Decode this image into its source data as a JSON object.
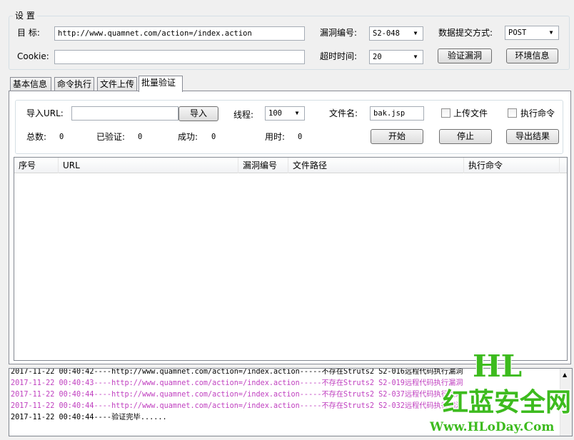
{
  "settings": {
    "group_title": "设 置",
    "target_label": "目  标:",
    "target_value": "http://www.quamnet.com/action=/index.action",
    "cookie_label": "Cookie:",
    "cookie_value": "",
    "vuln_id_label": "漏洞编号:",
    "vuln_id_value": "S2-048",
    "submit_method_label": "数据提交方式:",
    "submit_method_value": "POST",
    "timeout_label": "超时时间:",
    "timeout_value": "20",
    "verify_button": "验证漏洞",
    "env_button": "环境信息"
  },
  "tabs": [
    "基本信息",
    "命令执行",
    "文件上传",
    "批量验证"
  ],
  "batch": {
    "import_url_label": "导入URL:",
    "import_url_value": "",
    "import_button": "导入",
    "threads_label": "线程:",
    "threads_value": "100",
    "filename_label": "文件名:",
    "filename_value": "bak.jsp",
    "upload_file_label": "上传文件",
    "exec_cmd_label": "执行命令",
    "total_label": "总数:",
    "total_value": "0",
    "verified_label": "已验证:",
    "verified_value": "0",
    "success_label": "成功:",
    "success_value": "0",
    "time_label": "用时:",
    "time_value": "0",
    "start_button": "开始",
    "stop_button": "停止",
    "export_button": "导出结果",
    "columns": [
      "序号",
      "URL",
      "漏洞编号",
      "文件路径",
      "执行命令"
    ]
  },
  "log": {
    "lines": [
      {
        "text": "2017-11-22 00:40:42----http://www.quamnet.com/action=/index.action-----不存在Struts2 S2-016远程代码执行漏洞",
        "color": "#000000"
      },
      {
        "text": "2017-11-22 00:40:43----http://www.quamnet.com/action=/index.action-----不存在Struts2 S2-019远程代码执行漏洞",
        "color": "#c040c0"
      },
      {
        "text": "2017-11-22 00:40:44----http://www.quamnet.com/action=/index.action-----不存在Struts2 S2-037远程代码执行漏洞",
        "color": "#c040c0"
      },
      {
        "text": "2017-11-22 00:40:44----http://www.quamnet.com/action=/index.action-----不存在Struts2 S2-032远程代码执行漏洞",
        "color": "#c040c0"
      },
      {
        "text": "2017-11-22 00:40:44----验证完毕......",
        "color": "#000000"
      }
    ]
  },
  "watermark": {
    "logo": "HL",
    "title": "红蓝安全网",
    "url": "Www.HLoDay.Com",
    "colors": {
      "green": "#3dbb1e",
      "red": "#e0261b",
      "outline": "#ffffff"
    }
  }
}
